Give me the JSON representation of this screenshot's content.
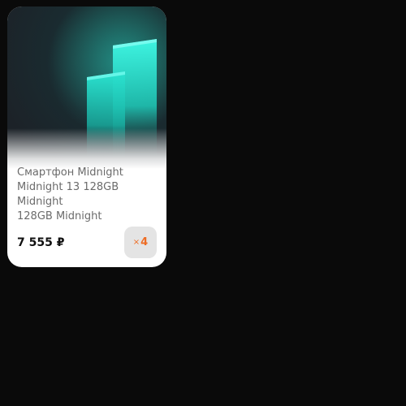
{
  "product": {
    "title_lines": [
      "Смартфон Midnight",
      "Midnight 13 128GB",
      "Midnight",
      "128GB Midnight"
    ],
    "price": "7 555 ₽",
    "quantity_prefix": "×",
    "quantity": "4",
    "image_icon": "smartphone-glow-image"
  },
  "colors": {
    "background": "#0a0a0a",
    "card": "#ffffff",
    "accent_cyan": "#2ee8d6",
    "quantity_text": "#ee6c24",
    "badge_bg": "#e4e4e4"
  }
}
